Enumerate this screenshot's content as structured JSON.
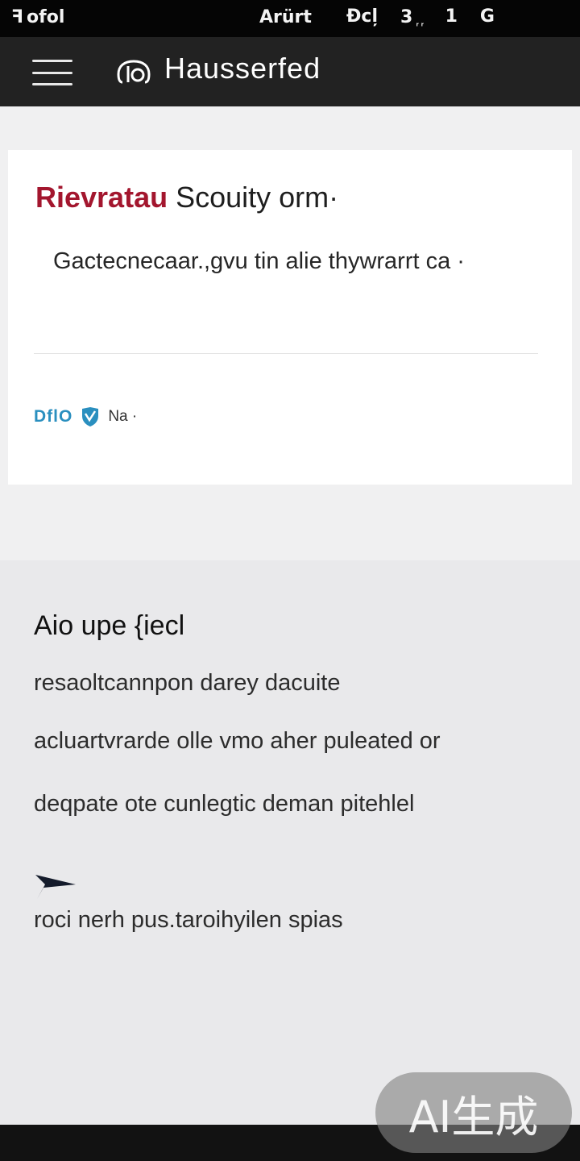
{
  "status_bar": {
    "left_text": "ofol",
    "middle_text": "Arürt",
    "right_items": [
      "Ɖcl̦",
      "3 ᷊ ᷊",
      "1",
      "G"
    ]
  },
  "app_bar": {
    "title": "Hausserfed"
  },
  "card": {
    "title_accent": "Rievratau",
    "title_rest": " Scouity orm·",
    "body": "Gactecnecaar.,gvu tin alie thywrarrt ca ·",
    "meta_code": "DflO",
    "meta_text": "Na ·"
  },
  "section": {
    "heading": "Aio upe {iecl",
    "lines": [
      "resaoltcannpon darey dacuite",
      "acluartvrarde olle vmo aher puleated or",
      "deqpate ote cunlegtic deman pitehlel"
    ],
    "footer_line": "roci nerh pus.taroihyilen spias"
  },
  "watermark": {
    "text": "AI生成"
  },
  "colors": {
    "accent": "#a3162e",
    "link": "#2a8fbf",
    "app_bar": "#222222",
    "status_bar": "#050505"
  },
  "icons": [
    "menu-icon",
    "logo-icon",
    "shield-check-icon",
    "arrow-icon"
  ]
}
